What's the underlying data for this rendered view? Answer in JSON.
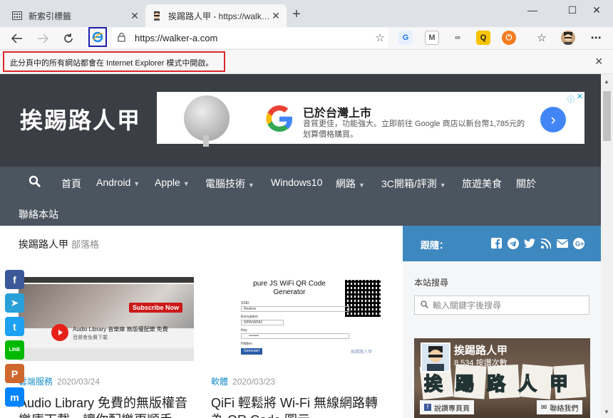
{
  "browser": {
    "tabs": [
      {
        "title": "新索引標籤",
        "active": false,
        "icon": "newtab-grid-icon"
      },
      {
        "title": "挨踢路人甲 - https://walker-a.com",
        "active": true,
        "icon": "walker-favicon"
      }
    ],
    "url": "https://walker-a.com",
    "ie_mode_message": "此分頁中的所有網站都會在 Internet Explorer 模式中開啟。"
  },
  "site": {
    "title": "挨踢路人甲",
    "nav": [
      {
        "label": "首頁",
        "dropdown": false
      },
      {
        "label": "Android",
        "dropdown": true
      },
      {
        "label": "Apple",
        "dropdown": true
      },
      {
        "label": "電腦技術",
        "dropdown": true
      },
      {
        "label": "Windows10",
        "dropdown": false
      },
      {
        "label": "網路",
        "dropdown": true
      },
      {
        "label": "3C開箱/評測",
        "dropdown": true
      },
      {
        "label": "旅遊美食",
        "dropdown": false
      },
      {
        "label": "關於",
        "dropdown": false
      },
      {
        "label": "聯絡本站",
        "dropdown": false
      }
    ],
    "breadcrumb": {
      "main": "挨踢路人甲",
      "sub": "部落格"
    }
  },
  "ad": {
    "headline": "已於台灣上市",
    "body": "音質更佳，功能強大。立即前往 Google 商店以新台幣1,785元的划算價格購買。"
  },
  "posts": [
    {
      "category": "雲端服務",
      "date": "2020/03/24",
      "title": "Audio Library 免費的無版權音樂庫下載，讓你配樂更順手",
      "thumb_heading": "Audio Library 音樂庫 無版權配樂 免費",
      "thumb_sub": "音樂會免費下載",
      "thumb_button": "Subscribe Now"
    },
    {
      "category": "軟體",
      "date": "2020/03/23",
      "title": "QiFi 輕鬆將 Wi-Fi 無線網路轉為 QR Code 圖示",
      "thumb_heading": "pure JS WiFi QR Code Generator",
      "thumb_fields": [
        "SSID",
        "Encryption",
        "Key",
        "Hidden"
      ],
      "thumb_ssid": "Realme",
      "thumb_encryption": "WPA/WPA2",
      "thumb_key": "••••••••",
      "thumb_button": "Generate!",
      "thumb_watermark": "挨踢路人甲"
    }
  ],
  "sidebar": {
    "follow_label": "跟隨：",
    "follow_icons": [
      "facebook-icon",
      "telegram-icon",
      "twitter-icon",
      "rss-icon",
      "mail-icon",
      "google-plus-icon"
    ],
    "search_title": "本站搜尋",
    "search_placeholder": "輸入關鍵字後搜尋",
    "fb_name": "挨踢路人甲",
    "fb_likes": "8,534 按讚次數",
    "fb_like_button": "說讚專頁頁",
    "fb_contact_button": "聯絡我們",
    "fb_banner_text": "挨踢路人甲"
  },
  "share_buttons": [
    {
      "name": "facebook-share",
      "glyph": "f",
      "color": "#3b5998"
    },
    {
      "name": "telegram-share",
      "glyph": "➤",
      "color": "#2aa0d8"
    },
    {
      "name": "twitter-share",
      "glyph": "t",
      "color": "#1da1f2"
    },
    {
      "name": "line-share",
      "glyph": "LINE",
      "color": "#00b900"
    },
    {
      "name": "plurk-share",
      "glyph": "P",
      "color": "#cf682f"
    },
    {
      "name": "messenger-share",
      "glyph": "m",
      "color": "#0084ff"
    }
  ]
}
